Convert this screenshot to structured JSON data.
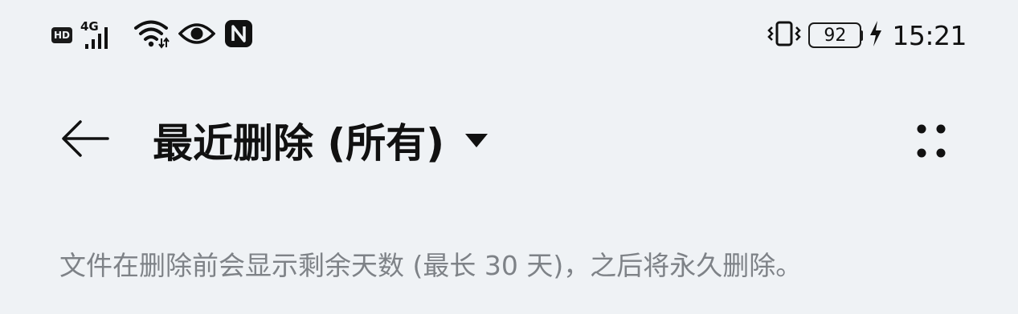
{
  "status_bar": {
    "hd_badge": "HD",
    "network_type": "4G",
    "battery_level": "92",
    "time": "15:21",
    "icons": [
      "hd-icon",
      "cellular-signal-icon",
      "wifi-icon",
      "eye-comfort-icon",
      "nfc-icon",
      "vibrate-icon",
      "battery-icon",
      "charging-icon"
    ]
  },
  "header": {
    "title": "最近删除 (所有)",
    "icons": [
      "back-arrow-icon",
      "dropdown-caret-icon",
      "more-options-icon"
    ]
  },
  "main": {
    "info_text": "文件在删除前会显示剩余天数 (最长 30 天)，之后将永久删除。"
  },
  "colors": {
    "background": "#eff2f5",
    "primary_text": "#111111",
    "secondary_text": "#7e8287"
  }
}
